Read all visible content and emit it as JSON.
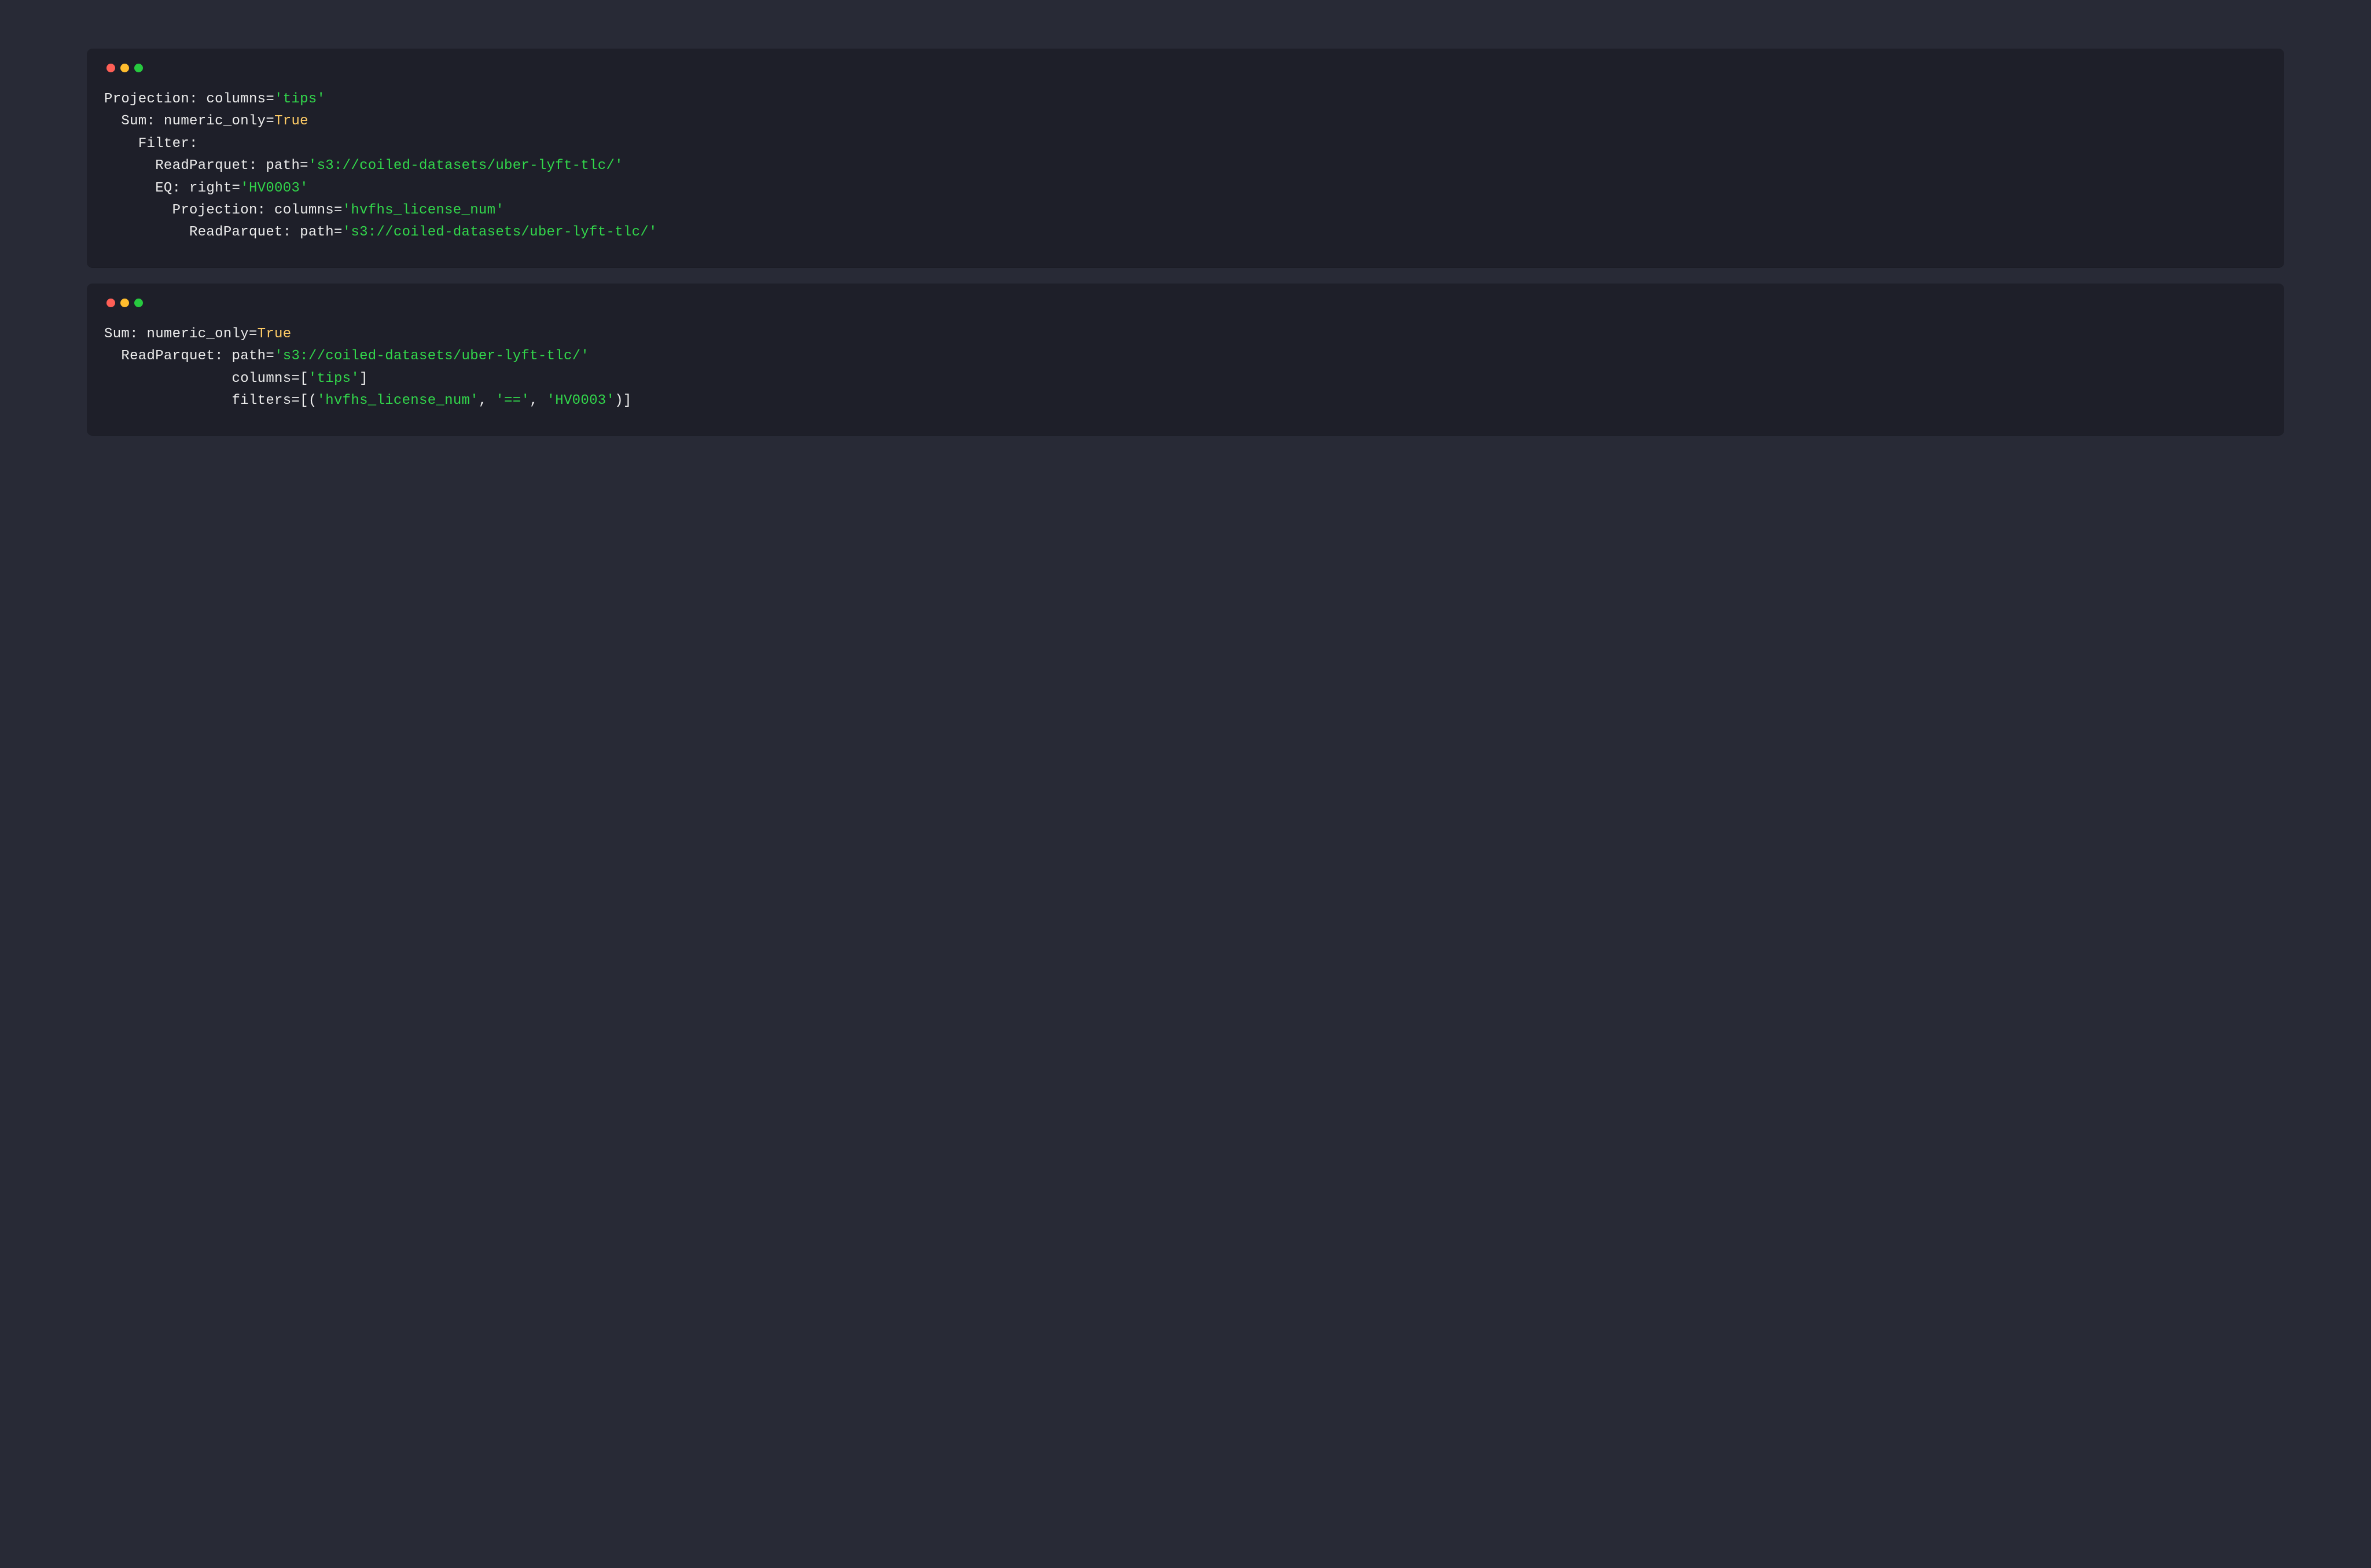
{
  "colors": {
    "page_bg": "#282a36",
    "panel_bg": "#1e1f29",
    "text": "#e6e6e6",
    "string": "#32d74b",
    "keyword": "#ffcc66",
    "traffic_red": "#ff5f56",
    "traffic_yellow": "#ffbd2e",
    "traffic_green": "#27c93f"
  },
  "panels": [
    {
      "id": "unoptimized-plan",
      "lines": [
        {
          "indent": 0,
          "segments": [
            {
              "cls": "plain",
              "text": "Projection: columns="
            },
            {
              "cls": "str",
              "text": "'tips'"
            }
          ]
        },
        {
          "indent": 1,
          "segments": [
            {
              "cls": "plain",
              "text": "Sum: numeric_only="
            },
            {
              "cls": "kw",
              "text": "True"
            }
          ]
        },
        {
          "indent": 2,
          "segments": [
            {
              "cls": "plain",
              "text": "Filter:"
            }
          ]
        },
        {
          "indent": 3,
          "segments": [
            {
              "cls": "plain",
              "text": "ReadParquet: path="
            },
            {
              "cls": "str",
              "text": "'s3://coiled-datasets/uber-lyft-tlc/'"
            }
          ]
        },
        {
          "indent": 3,
          "segments": [
            {
              "cls": "plain",
              "text": "EQ: right="
            },
            {
              "cls": "str",
              "text": "'HV0003'"
            }
          ]
        },
        {
          "indent": 4,
          "segments": [
            {
              "cls": "plain",
              "text": "Projection: columns="
            },
            {
              "cls": "str",
              "text": "'hvfhs_license_num'"
            }
          ]
        },
        {
          "indent": 5,
          "segments": [
            {
              "cls": "plain",
              "text": "ReadParquet: path="
            },
            {
              "cls": "str",
              "text": "'s3://coiled-datasets/uber-lyft-tlc/'"
            }
          ]
        }
      ]
    },
    {
      "id": "optimized-plan",
      "lines": [
        {
          "indent": 0,
          "segments": [
            {
              "cls": "plain",
              "text": "Sum: numeric_only="
            },
            {
              "cls": "kw",
              "text": "True"
            }
          ]
        },
        {
          "indent": 1,
          "segments": [
            {
              "cls": "plain",
              "text": "ReadParquet: path="
            },
            {
              "cls": "str",
              "text": "'s3://coiled-datasets/uber-lyft-tlc/'"
            }
          ]
        },
        {
          "indent": 1,
          "align_to": "ReadParquet: ",
          "segments": [
            {
              "cls": "plain",
              "text": "columns=["
            },
            {
              "cls": "str",
              "text": "'tips'"
            },
            {
              "cls": "plain",
              "text": "]"
            }
          ]
        },
        {
          "indent": 1,
          "align_to": "ReadParquet: ",
          "segments": [
            {
              "cls": "plain",
              "text": "filters=[("
            },
            {
              "cls": "str",
              "text": "'hvfhs_license_num'"
            },
            {
              "cls": "plain",
              "text": ", "
            },
            {
              "cls": "str",
              "text": "'=='"
            },
            {
              "cls": "plain",
              "text": ", "
            },
            {
              "cls": "str",
              "text": "'HV0003'"
            },
            {
              "cls": "plain",
              "text": ")]"
            }
          ]
        }
      ]
    }
  ]
}
